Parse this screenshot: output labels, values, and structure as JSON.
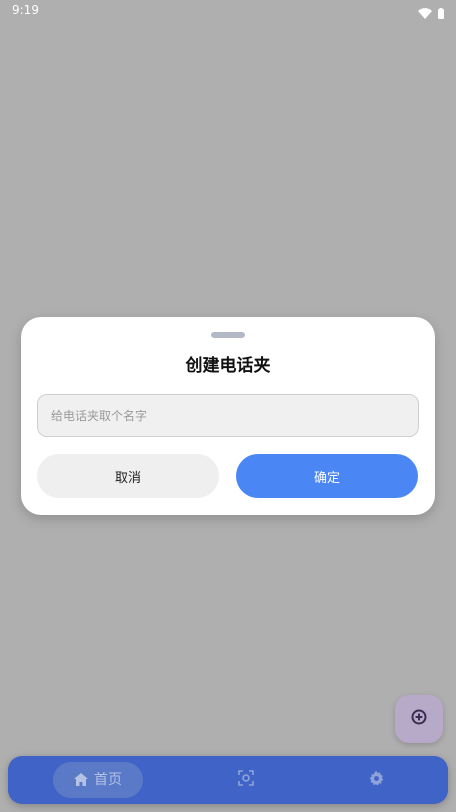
{
  "status_bar": {
    "time": "9:19",
    "icons": [
      "wifi-icon",
      "battery-icon"
    ]
  },
  "dialog": {
    "title": "创建电话夹",
    "input_placeholder": "给电话夹取个名字",
    "input_value": "",
    "cancel_label": "取消",
    "confirm_label": "确定"
  },
  "fab": {
    "icon": "add-circle-icon"
  },
  "bottom_nav": {
    "items": [
      {
        "label": "首页",
        "icon": "home-icon",
        "active": true
      },
      {
        "label": "",
        "icon": "scan-icon",
        "active": false
      },
      {
        "label": "",
        "icon": "settings-icon",
        "active": false
      }
    ]
  },
  "colors": {
    "scrim": "#afafaf",
    "accent": "#4a86f4",
    "nav_background": "#3f63c6",
    "fab_background": "#b7a9c8"
  }
}
